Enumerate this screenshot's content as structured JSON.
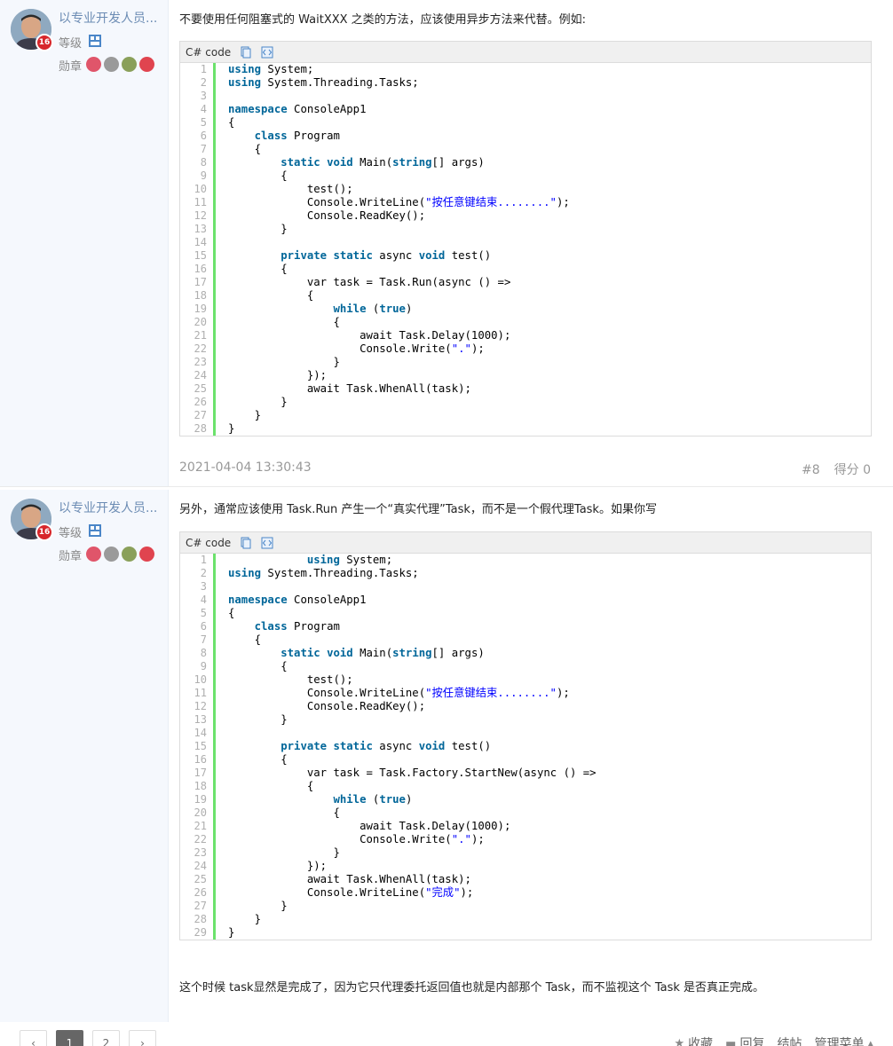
{
  "posts": [
    {
      "user": {
        "name": "以专业开发人员...",
        "level_badge": "16",
        "level_label": "等级",
        "medal_label": "勋章"
      },
      "intro": "不要使用任何阻塞式的 WaitXXX 之类的方法，应该使用异步方法来代替。例如:",
      "code": {
        "lang": "C# code",
        "lines": [
          {
            "n": "1",
            "t": "using System;"
          },
          {
            "n": "2",
            "t": "using System.Threading.Tasks;"
          },
          {
            "n": "3",
            "t": ""
          },
          {
            "n": "4",
            "t": "namespace ConsoleApp1"
          },
          {
            "n": "5",
            "t": "{"
          },
          {
            "n": "6",
            "t": "    class Program"
          },
          {
            "n": "7",
            "t": "    {"
          },
          {
            "n": "8",
            "t": "        static void Main(string[] args)"
          },
          {
            "n": "9",
            "t": "        {"
          },
          {
            "n": "10",
            "t": "            test();"
          },
          {
            "n": "11",
            "t": "            Console.WriteLine(\"按任意键结束........\");"
          },
          {
            "n": "12",
            "t": "            Console.ReadKey();"
          },
          {
            "n": "13",
            "t": "        }"
          },
          {
            "n": "14",
            "t": ""
          },
          {
            "n": "15",
            "t": "        private static async void test()"
          },
          {
            "n": "16",
            "t": "        {"
          },
          {
            "n": "17",
            "t": "            var task = Task.Run(async () =>"
          },
          {
            "n": "18",
            "t": "            {"
          },
          {
            "n": "19",
            "t": "                while (true)"
          },
          {
            "n": "20",
            "t": "                {"
          },
          {
            "n": "21",
            "t": "                    await Task.Delay(1000);"
          },
          {
            "n": "22",
            "t": "                    Console.Write(\".\");"
          },
          {
            "n": "23",
            "t": "                }"
          },
          {
            "n": "24",
            "t": "            });"
          },
          {
            "n": "25",
            "t": "            await Task.WhenAll(task);"
          },
          {
            "n": "26",
            "t": "        }"
          },
          {
            "n": "27",
            "t": "    }"
          },
          {
            "n": "28",
            "t": "}"
          }
        ]
      },
      "footer": {
        "date": "2021-04-04 13:30:43",
        "floor": "#8",
        "score": "得分 0"
      }
    },
    {
      "user": {
        "name": "以专业开发人员...",
        "level_badge": "16",
        "level_label": "等级",
        "medal_label": "勋章"
      },
      "intro": "另外，通常应该使用 Task.Run 产生一个“真实代理”Task，而不是一个假代理Task。如果你写",
      "code": {
        "lang": "C# code",
        "lines": [
          {
            "n": "1",
            "t": "            using System;"
          },
          {
            "n": "2",
            "t": "using System.Threading.Tasks;"
          },
          {
            "n": "3",
            "t": ""
          },
          {
            "n": "4",
            "t": "namespace ConsoleApp1"
          },
          {
            "n": "5",
            "t": "{"
          },
          {
            "n": "6",
            "t": "    class Program"
          },
          {
            "n": "7",
            "t": "    {"
          },
          {
            "n": "8",
            "t": "        static void Main(string[] args)"
          },
          {
            "n": "9",
            "t": "        {"
          },
          {
            "n": "10",
            "t": "            test();"
          },
          {
            "n": "11",
            "t": "            Console.WriteLine(\"按任意键结束........\");"
          },
          {
            "n": "12",
            "t": "            Console.ReadKey();"
          },
          {
            "n": "13",
            "t": "        }"
          },
          {
            "n": "14",
            "t": ""
          },
          {
            "n": "15",
            "t": "        private static async void test()"
          },
          {
            "n": "16",
            "t": "        {"
          },
          {
            "n": "17",
            "t": "            var task = Task.Factory.StartNew(async () =>"
          },
          {
            "n": "18",
            "t": "            {"
          },
          {
            "n": "19",
            "t": "                while (true)"
          },
          {
            "n": "20",
            "t": "                {"
          },
          {
            "n": "21",
            "t": "                    await Task.Delay(1000);"
          },
          {
            "n": "22",
            "t": "                    Console.Write(\".\");"
          },
          {
            "n": "23",
            "t": "                }"
          },
          {
            "n": "24",
            "t": "            });"
          },
          {
            "n": "25",
            "t": "            await Task.WhenAll(task);"
          },
          {
            "n": "26",
            "t": "            Console.WriteLine(\"完成\");"
          },
          {
            "n": "27",
            "t": "        }"
          },
          {
            "n": "28",
            "t": "    }"
          },
          {
            "n": "29",
            "t": "}"
          }
        ]
      },
      "outro": "这个时候 task显然是完成了，因为它只代理委托返回值也就是内部那个 Task，而不监视这个 Task 是否真正完成。"
    }
  ],
  "pager": {
    "prev": "‹",
    "pages": [
      "1",
      "2"
    ],
    "next": "›",
    "current": "1"
  },
  "actions": {
    "favorite": "收藏",
    "reply": "回复",
    "close": "结帖",
    "admin_menu": "管理菜单"
  },
  "colors": {
    "keyword": "#006699",
    "string": "#0000ff",
    "gutter_bar": "#6ce26c",
    "username": "#6c8cb4"
  }
}
